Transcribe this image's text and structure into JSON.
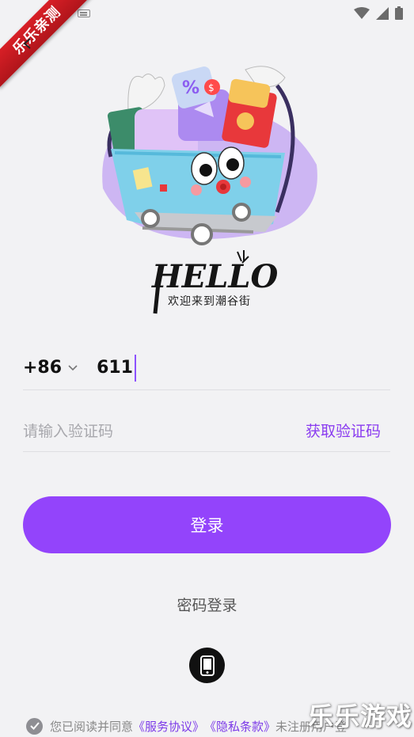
{
  "ribbon": {
    "label": "乐乐亲测"
  },
  "hero": {
    "tagline": "欢迎来到潮谷街"
  },
  "phone": {
    "country_code": "+86",
    "value": "611"
  },
  "code": {
    "placeholder": "请输入验证码",
    "get_code_label": "获取验证码"
  },
  "login": {
    "label": "登录"
  },
  "alt_login": {
    "password_label": "密码登录"
  },
  "agreement": {
    "prefix": "您已阅读并同意",
    "service_link": "《服务协议》",
    "privacy_link": "《隐私条款》",
    "suffix": "未注册用户登"
  },
  "watermark": {
    "text": "乐乐游戏"
  },
  "colors": {
    "accent": "#9344fb",
    "link": "#7c3ae8",
    "background": "#f2f2f4"
  }
}
